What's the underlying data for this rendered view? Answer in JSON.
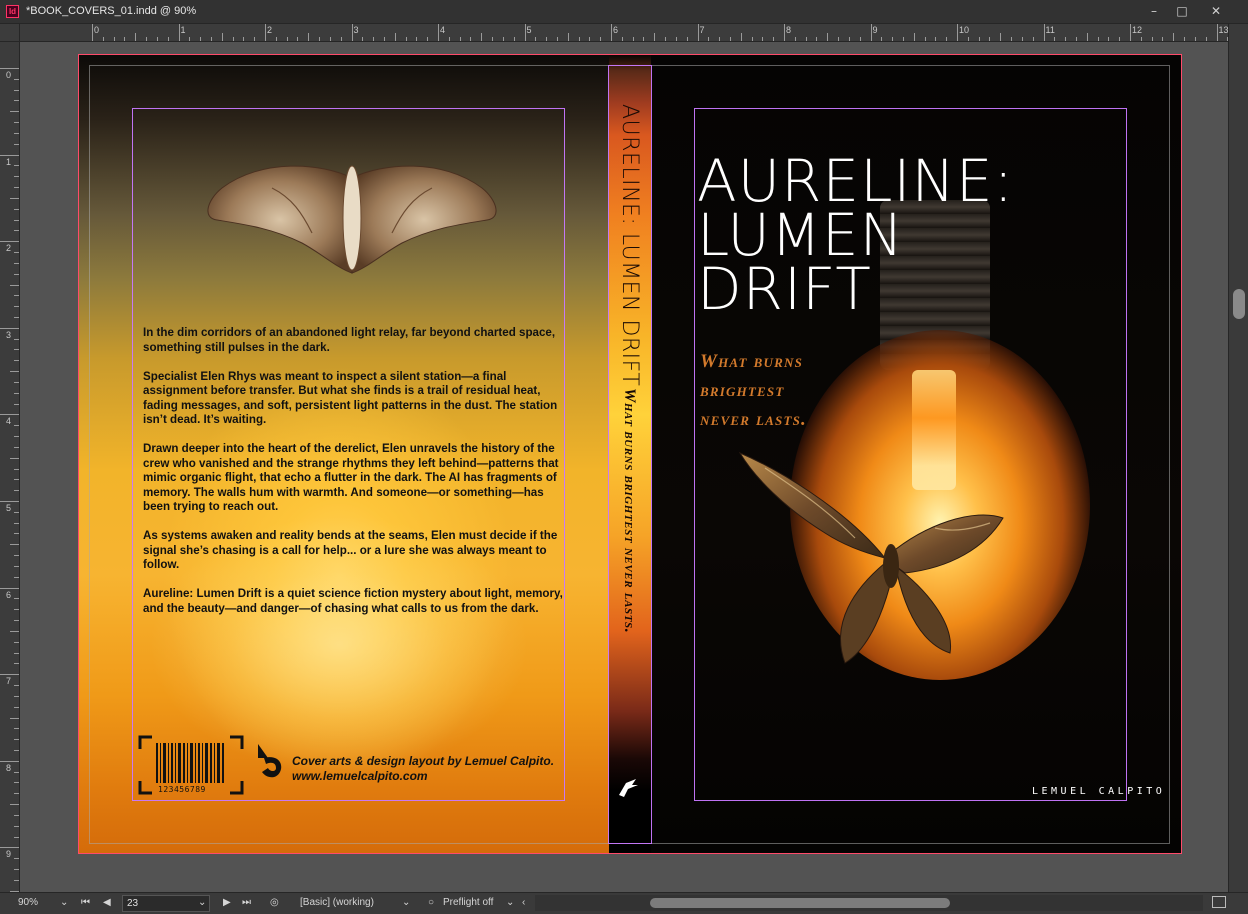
{
  "window": {
    "title": "*BOOK_COVERS_01.indd @ 90%",
    "app_badge": "Id",
    "minimize_glyph": "–",
    "maximize_glyph": "□",
    "close_glyph": "✕"
  },
  "rulers": {
    "horizontal_labels": [
      "0",
      "1",
      "2",
      "3",
      "4",
      "5",
      "6",
      "7",
      "8",
      "9",
      "10",
      "11",
      "12",
      "13"
    ],
    "vertical_labels": [
      "0",
      "1",
      "2",
      "3",
      "4",
      "5",
      "6",
      "7",
      "8",
      "9"
    ]
  },
  "back_cover": {
    "blurb": [
      "In the dim corridors of an abandoned light relay, far beyond charted space, something still pulses in the dark.",
      "Specialist Elen Rhys was meant to inspect a silent station—a final assignment before transfer. But what she finds is a trail of residual heat, fading messages, and soft, persistent light patterns in the dust. The station isn’t dead. It’s waiting.",
      "Drawn deeper into the heart of the derelict, Elen unravels the history of the crew who vanished and the strange rhythms they left behind—patterns that mimic organic flight, that echo a flutter in the dark. The AI has fragments of memory. The walls hum with warmth. And someone—or something—has been trying to reach out.",
      "As systems awaken and reality bends at the seams, Elen must decide if the signal she’s chasing is a call for help... or a lure she was always meant to follow.",
      "Aureline: Lumen Drift is a quiet science fiction mystery about light, memory, and the beauty—and danger—of chasing what calls to us from the dark."
    ],
    "barcode_digits": "123456789",
    "credit_line1": "Cover arts & design layout by Lemuel Calpito.",
    "credit_line2": "www.lemuelcalpito.com"
  },
  "spine": {
    "title": "AURELINE: LUMEN DRIFT",
    "tagline": "What burns brightest never lasts."
  },
  "front_cover": {
    "title_lines": [
      "AURELINE:",
      "LUMEN",
      "DRIFT"
    ],
    "tagline_lines": [
      "What burns",
      "brightest",
      "never lasts."
    ],
    "author": "LEMUEL CALPITO"
  },
  "statusbar": {
    "zoom": "90%",
    "page": "23",
    "style": "[Basic] (working)",
    "preflight": "Preflight off",
    "first_glyph": "⏮",
    "prev_glyph": "◀",
    "next_glyph": "▶",
    "last_glyph": "⏭"
  },
  "colors": {
    "guide_margin": "#c878ff",
    "bleed": "#ff4a6a",
    "tagline": "#d37a2c",
    "pasteboard": "#535353"
  }
}
